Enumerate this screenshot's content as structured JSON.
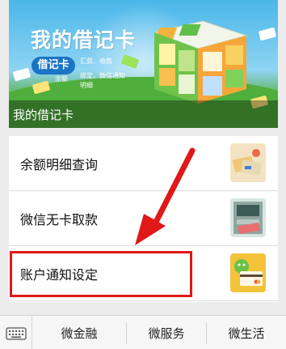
{
  "banner": {
    "title": "我的借记卡",
    "pill": "借记卡",
    "features": [
      "汇款、收款",
      "余额",
      "绑定、微信通知",
      "明细"
    ],
    "caption": "我的借记卡"
  },
  "menu": {
    "items": [
      {
        "label": "余额明细查询",
        "icon": "cards-icon"
      },
      {
        "label": "微信无卡取款",
        "icon": "atm-icon"
      },
      {
        "label": "账户通知设定",
        "icon": "notification-card-icon"
      }
    ]
  },
  "tabbar": {
    "tabs": [
      "微金融",
      "微服务",
      "微生活"
    ],
    "keyboard_icon": "keyboard-icon"
  },
  "colors": {
    "highlight": "#e01818",
    "arrow": "#e01818",
    "pill": "#1b74c6"
  }
}
